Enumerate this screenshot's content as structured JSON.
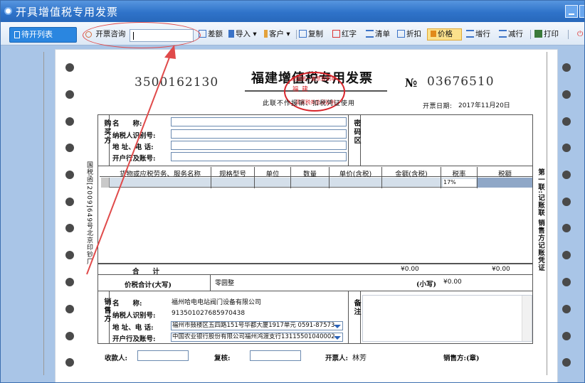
{
  "window": {
    "title": "开具增值税专用发票"
  },
  "toolbar": {
    "pending_list": "待开列表",
    "inquiry_label": "开票咨询",
    "inquiry_value": "",
    "discount": "差额",
    "import": "导入",
    "customer": "客户",
    "copy": "复制",
    "red": "红字",
    "list": "清单",
    "deduct": "折扣",
    "price": "价格",
    "add_row": "增行",
    "del_row": "减行",
    "print": "打印"
  },
  "invoice": {
    "code": "3500162130",
    "title": "福建增值税专用发票",
    "no_label": "№",
    "number": "03676510",
    "note": "此联不作报销、扣税凭证使用",
    "date_label": "开票日期:",
    "date": "2017年11月20日",
    "seal_top": "全国统一发票监制章",
    "seal_mid": "福 建",
    "seal_bottom": "国家税务总局监制",
    "buyer": {
      "side": "购买方",
      "name_label": "名　　称:",
      "tax_id_label": "纳税人识别号:",
      "address_label": "地 址、电 话:",
      "bank_label": "开户行及账号:",
      "cipher_label": "密码区"
    },
    "table": {
      "headers": [
        "货物或应税劳务、服务名称",
        "规格型号",
        "单位",
        "数量",
        "单价(含税)",
        "金额(含税)",
        "税率",
        "税额"
      ],
      "rows": [
        {
          "tax_rate": "17%"
        }
      ]
    },
    "total_label": "合　　计",
    "total_amount": "¥0.00",
    "total_tax": "¥0.00",
    "caps_label": "价税合计(大写)",
    "caps_value": "零圆整",
    "small_label": "(小写)",
    "small_value": "¥0.00",
    "seller": {
      "side": "销售方",
      "name_label": "名　　称:",
      "name": "福州哈电电站阀门设备有限公司",
      "tax_id_label": "纳税人识别号:",
      "tax_id": "913501027685970438",
      "address_label": "地 址、电 话:",
      "address": "福州市鼓楼区五四路151号华都大厦1917单元 0591-87573",
      "bank_label": "开户行及账号:",
      "bank": "中国农业银行股份有限公司福州鸿渡支行13115501040002",
      "remark_label": "备注"
    },
    "side_left": "国税函[2009]649号北京印钞厂",
    "side_right": "第一联:记账联 销售方记账凭证",
    "payee_label": "收款人:",
    "reviewer_label": "复核:",
    "drawer_label": "开票人:",
    "drawer": "林芳",
    "seller_stamp": "销售方:(章)"
  },
  "colors": {
    "accent": "#2a86e0",
    "titlebar": "#2f73c9",
    "highlight": "#fbe18c",
    "annotation": "#e04a4a"
  }
}
